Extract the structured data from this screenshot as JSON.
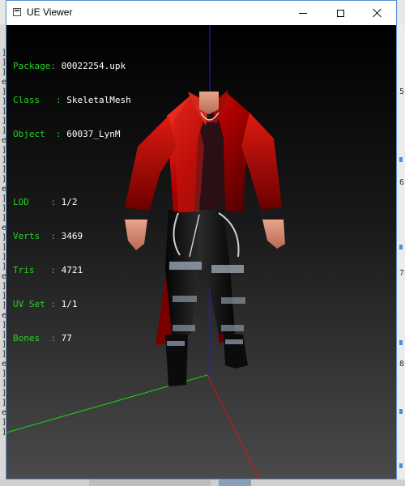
{
  "window": {
    "title": "UE Viewer",
    "minimize_symbol": "—",
    "maximize_symbol": "☐",
    "close_symbol": "✕"
  },
  "info": {
    "package": {
      "label": "Package",
      "value": "00022254.upk"
    },
    "class": {
      "label": "Class",
      "value": "SkeletalMesh"
    },
    "object": {
      "label": "Object",
      "value": "60037_LynM"
    },
    "lod": {
      "label": "LOD",
      "value": "1/2"
    },
    "verts": {
      "label": "Verts",
      "value": "3469"
    },
    "tris": {
      "label": "Tris",
      "value": "4721"
    },
    "uv_set": {
      "label": "UV Set",
      "value": "1/1"
    },
    "bones": {
      "label": "Bones",
      "value": "77"
    }
  },
  "background": {
    "left_glyphs": [
      "]",
      "]",
      "]",
      "e",
      "]",
      "]",
      "]",
      "]",
      "]",
      "e",
      "]",
      "]",
      "]",
      "]",
      "e",
      "]",
      "]",
      "]",
      "e",
      "]",
      "]",
      "]",
      "]",
      "e",
      "]",
      "]",
      "]",
      "e",
      "]",
      "]",
      "]",
      "]",
      "e",
      "]",
      "]",
      "]",
      "]",
      "e",
      "]",
      "]"
    ],
    "right_numbers": [
      "5",
      "6",
      "7",
      "8"
    ]
  },
  "colors": {
    "label_green": "#27d127",
    "value_white": "#ffffff",
    "axis_x": "#e01010",
    "axis_y": "#10dd10",
    "axis_z": "#1a1aff",
    "coat_red": "#b00000",
    "pants_black": "#111111"
  },
  "icons": {
    "app": "window-app-icon",
    "minimize": "minimize-icon",
    "maximize": "maximize-icon",
    "close": "close-icon"
  }
}
